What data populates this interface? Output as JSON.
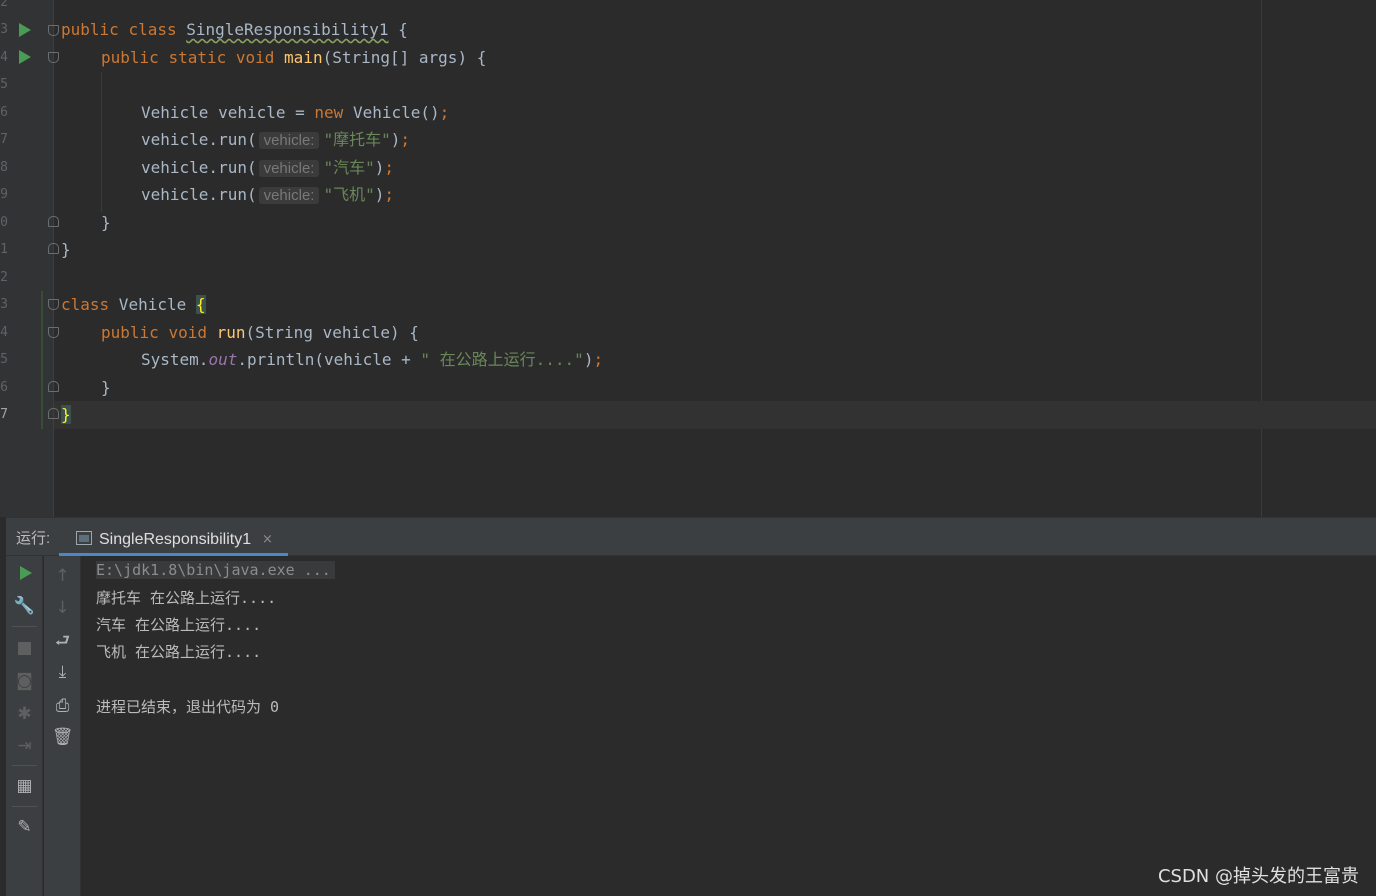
{
  "editor": {
    "lines": [
      {
        "num": "2"
      },
      {
        "num": "3"
      },
      {
        "num": "4"
      },
      {
        "num": "5"
      },
      {
        "num": "6"
      },
      {
        "num": "7"
      },
      {
        "num": "8"
      },
      {
        "num": "9"
      },
      {
        "num": "0"
      },
      {
        "num": "1"
      },
      {
        "num": "2"
      },
      {
        "num": "3"
      },
      {
        "num": "4"
      },
      {
        "num": "5"
      },
      {
        "num": "6"
      },
      {
        "num": "7"
      }
    ],
    "code": {
      "kw_public": "public",
      "kw_class": "class",
      "kw_static": "static",
      "kw_void": "void",
      "kw_new": "new",
      "class_main": "SingleResponsibility1",
      "open_brace": " {",
      "close_brace": "}",
      "main_name": "main",
      "main_params": "(String[] args) {",
      "vehicle_decl": "Vehicle vehicle = ",
      "vehicle_ctor": "Vehicle()",
      "semicolon": ";",
      "call_prefix": "vehicle.run(",
      "param_hint": "vehicle:",
      "arg1": "\"摩托车\"",
      "arg2": "\"汽车\"",
      "arg3": "\"飞机\"",
      "call_suffix": ")",
      "class_vehicle": " Vehicle ",
      "brace_open": "{",
      "run_name": "run",
      "run_params": "(String vehicle) {",
      "system": "System.",
      "out": "out",
      "println": ".println(vehicle + ",
      "str_suffix": "\" 在公路上运行....\"",
      "close_paren": ")"
    }
  },
  "run_panel": {
    "title": "运行:",
    "tab_label": "SingleResponsibility1",
    "tab_close": "×",
    "console_lines": [
      "E:\\jdk1.8\\bin\\java.exe ...",
      "摩托车 在公路上运行....",
      "汽车 在公路上运行....",
      "飞机 在公路上运行....",
      "",
      "进程已结束，退出代码为 0"
    ],
    "toolbar1_icons": [
      "run-icon",
      "wrench-icon",
      "stop-icon",
      "camera-icon",
      "debug-icon",
      "exit-icon",
      "layout-icon",
      "pin-icon"
    ],
    "toolbar2_icons": [
      "up-arrow-icon",
      "down-arrow-icon",
      "soft-wrap-icon",
      "scroll-to-end-icon",
      "print-icon",
      "trash-icon"
    ]
  },
  "watermark": "CSDN @掉头发的王富贵",
  "colors": {
    "background": "#2b2b2b",
    "keyword": "#cc7832",
    "string": "#6a8759",
    "method": "#ffc66d",
    "field": "#9876aa",
    "run_green": "#499c54",
    "tab_accent": "#4a88c7"
  }
}
